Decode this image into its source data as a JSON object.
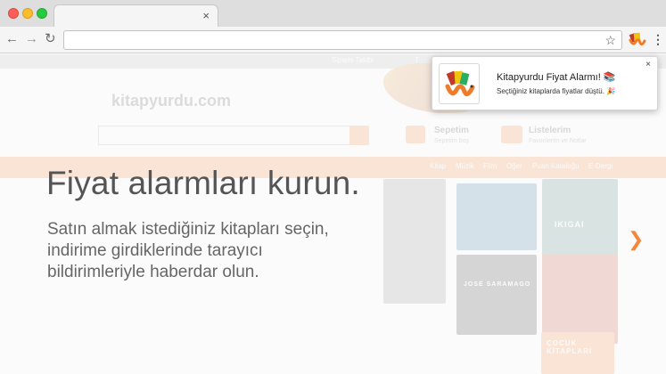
{
  "browser": {
    "tab_close": "×",
    "back_icon": "arrow-left-icon",
    "forward_icon": "arrow-right-icon",
    "reload_icon": "reload-icon",
    "bookmark_icon": "star-icon",
    "menu_icon": "kebab-menu-icon",
    "address": ""
  },
  "background_site": {
    "logo": "kitapyurdu.com",
    "header_links": [
      "Siparis Takibi",
      "T"
    ],
    "cart_label": "Sepetim",
    "cart_sub": "Sepetim boş",
    "lists_label": "Listelerim",
    "lists_sub": "Favorilerim ve Notlar",
    "nav_items": [
      "Kitap",
      "Müzik",
      "Film",
      "Oğer",
      "Puan Kataloğu",
      "E-Dergi"
    ],
    "books": [
      "IKIGAI",
      "JOSÉ SARAMAGO",
      "ÇOCUK KİTAPLARI"
    ],
    "accent_color": "#f07c2a"
  },
  "hero": {
    "title": "Fiyat alarmları kurun.",
    "body_lines": [
      "Satın almak istediğiniz kitapları seçin,",
      "indirime girdiklerinde tarayıcı",
      "bildirimleriyle haberdar olun."
    ]
  },
  "notification": {
    "title": "Kitapyurdu Fiyat Alarmı! 📚",
    "message": "Seçtiğiniz kitaplarda fiyatlar düştü. 🎉",
    "close": "×",
    "icon": "kitapyurdu-worm-icon"
  }
}
